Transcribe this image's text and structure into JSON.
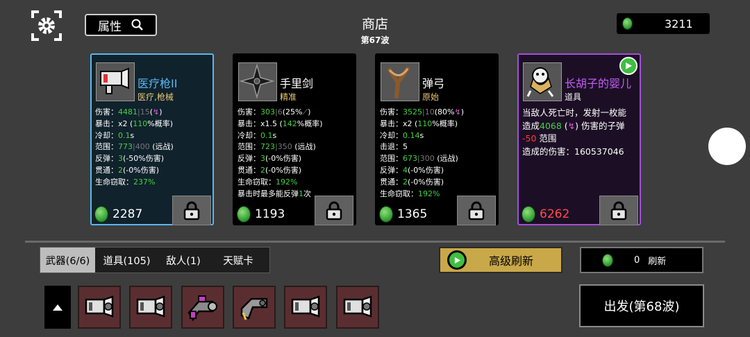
{
  "header": {
    "search_label": "属性",
    "title": "商店",
    "wave": "第67波",
    "money": "3211"
  },
  "cards": [
    {
      "name": "医疗枪II",
      "type": "医疗,枪械",
      "name_color": "#5ab8f0",
      "border_color": "#5ab8f0",
      "bg_color": "#10222c",
      "stats": [
        [
          {
            "t": "伤害："
          },
          {
            "t": "4481",
            "c": "g"
          },
          {
            "t": "|",
            "c": "dg"
          },
          {
            "t": "15",
            "c": "dg"
          },
          {
            "t": "("
          },
          {
            "t": "↯",
            "c": "pk"
          },
          {
            "t": ")"
          }
        ],
        [
          {
            "t": "暴击：x2 ("
          },
          {
            "t": "110",
            "c": "g"
          },
          {
            "t": "%概率)"
          }
        ],
        [
          {
            "t": "冷却："
          },
          {
            "t": "0.1",
            "c": "g"
          },
          {
            "t": "s"
          }
        ],
        [
          {
            "t": "范围："
          },
          {
            "t": "773",
            "c": "g"
          },
          {
            "t": "|",
            "c": "dg"
          },
          {
            "t": "400",
            "c": "dg"
          },
          {
            "t": " (远战)"
          }
        ],
        [
          {
            "t": "反弹："
          },
          {
            "t": "3",
            "c": "g"
          },
          {
            "t": "(-50%伤害)"
          }
        ],
        [
          {
            "t": "贯通："
          },
          {
            "t": "2",
            "c": "g"
          },
          {
            "t": "(-0%伤害)"
          }
        ],
        [
          {
            "t": "生命窃取："
          },
          {
            "t": "237%",
            "c": "g"
          }
        ]
      ],
      "price": "2287",
      "price_color": "#ffffff"
    },
    {
      "name": "手里剑",
      "type": "精准",
      "name_color": "#ffffff",
      "border_color": "#000000",
      "bg_color": "#000000",
      "stats": [
        [
          {
            "t": "伤害："
          },
          {
            "t": "303",
            "c": "g"
          },
          {
            "t": "|",
            "c": "dg"
          },
          {
            "t": "6",
            "c": "dg"
          },
          {
            "t": "(25%"
          },
          {
            "t": "⟋",
            "c": "g"
          },
          {
            "t": ")"
          }
        ],
        [
          {
            "t": "暴击：x1.5 ("
          },
          {
            "t": "142",
            "c": "g"
          },
          {
            "t": "%概率)"
          }
        ],
        [
          {
            "t": "冷却："
          },
          {
            "t": "0.1",
            "c": "g"
          },
          {
            "t": "s"
          }
        ],
        [
          {
            "t": "范围："
          },
          {
            "t": "723",
            "c": "g"
          },
          {
            "t": "|",
            "c": "dg"
          },
          {
            "t": "350",
            "c": "dg"
          },
          {
            "t": " (远战)"
          }
        ],
        [
          {
            "t": "反弹："
          },
          {
            "t": "3",
            "c": "g"
          },
          {
            "t": "(-0%伤害)"
          }
        ],
        [
          {
            "t": "贯通："
          },
          {
            "t": "2",
            "c": "g"
          },
          {
            "t": "(-0%伤害)"
          }
        ],
        [
          {
            "t": "生命窃取："
          },
          {
            "t": "192%",
            "c": "g"
          }
        ],
        [
          {
            "t": "暴击时最多能反弹"
          },
          {
            "t": "1",
            "c": "g"
          },
          {
            "t": "次"
          }
        ]
      ],
      "price": "1193",
      "price_color": "#ffffff"
    },
    {
      "name": "弹弓",
      "type": "原始",
      "name_color": "#ffffff",
      "border_color": "#000000",
      "bg_color": "#000000",
      "stats": [
        [
          {
            "t": "伤害："
          },
          {
            "t": "3525",
            "c": "g"
          },
          {
            "t": "|",
            "c": "dg"
          },
          {
            "t": "10",
            "c": "dg"
          },
          {
            "t": "(80%"
          },
          {
            "t": "↯",
            "c": "pk"
          },
          {
            "t": ")"
          }
        ],
        [
          {
            "t": "暴击：x2 ("
          },
          {
            "t": "110",
            "c": "g"
          },
          {
            "t": "%概率)"
          }
        ],
        [
          {
            "t": "冷却："
          },
          {
            "t": "0.14",
            "c": "g"
          },
          {
            "t": "s"
          }
        ],
        [
          {
            "t": "击退：5"
          }
        ],
        [
          {
            "t": "范围："
          },
          {
            "t": "673",
            "c": "g"
          },
          {
            "t": "|",
            "c": "dg"
          },
          {
            "t": "300",
            "c": "dg"
          },
          {
            "t": " (远战)"
          }
        ],
        [
          {
            "t": "反弹："
          },
          {
            "t": "4",
            "c": "g"
          },
          {
            "t": "(-0%伤害)"
          }
        ],
        [
          {
            "t": "贯通："
          },
          {
            "t": "2",
            "c": "g"
          },
          {
            "t": "(-0%伤害)"
          }
        ],
        [
          {
            "t": "生命窃取："
          },
          {
            "t": "192%",
            "c": "g"
          }
        ]
      ],
      "price": "1365",
      "price_color": "#ffffff"
    },
    {
      "name": "长胡子的婴儿",
      "type": "道具",
      "name_color": "#c45cf5",
      "border_color": "#a44fd6",
      "bg_color": "#1c0f25",
      "stats": [
        [
          {
            "t": "当敌人死亡时，发射一枚能"
          }
        ],
        [
          {
            "t": "造成"
          },
          {
            "t": "4068",
            "c": "g"
          },
          {
            "t": " ("
          },
          {
            "t": "↯",
            "c": "pk"
          },
          {
            "t": ") 伤害的子弹"
          }
        ],
        [
          {
            "t": "-50",
            "c": "r"
          },
          {
            "t": " 范围"
          }
        ],
        [
          {
            "t": "造成的伤害：160537046"
          }
        ]
      ],
      "price": "6262",
      "price_color": "#ff4b4b"
    }
  ],
  "tabs": [
    {
      "label": "武器(6/6)"
    },
    {
      "label": "道具(105)"
    },
    {
      "label": "敌人(1)"
    },
    {
      "label": "天赋卡"
    }
  ],
  "buttons": {
    "advanced_refresh": "高级刷新",
    "refresh_cost": "0",
    "refresh_label": "刷新",
    "depart": "出发(第68波)"
  },
  "inventory": [
    {
      "icon": "medical-gun-icon"
    },
    {
      "icon": "medical-gun-icon"
    },
    {
      "icon": "plasma-gun-icon"
    },
    {
      "icon": "taser-gun-icon"
    },
    {
      "icon": "medical-gun-icon"
    },
    {
      "icon": "medical-gun-icon"
    }
  ],
  "colors": {
    "accent_gold": "#c9a849",
    "stat_green": "#43d243",
    "background": "#3d3d3d"
  }
}
